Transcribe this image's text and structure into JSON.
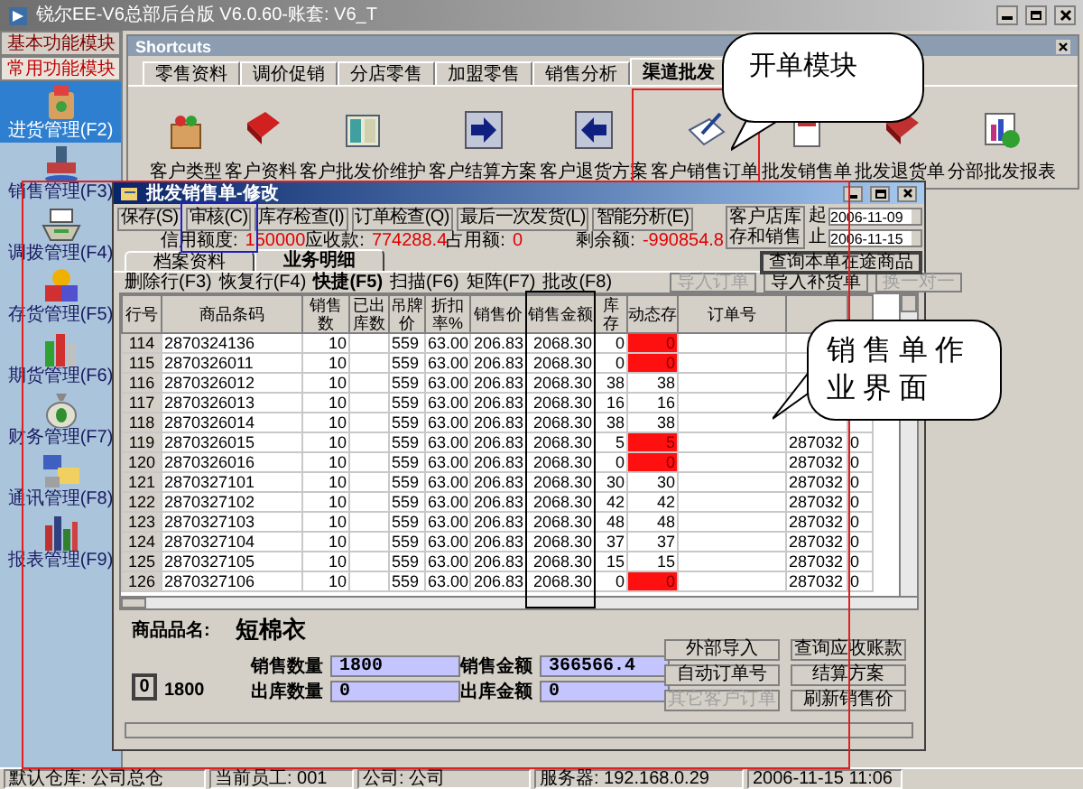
{
  "window": {
    "title": "锐尔EE-V6总部后台版 V6.0.60-账套: V6_T"
  },
  "sidebar": {
    "groups": [
      {
        "label": "基本功能模块",
        "selected": false
      },
      {
        "label": "常用功能模块",
        "selected": true
      }
    ],
    "items": [
      {
        "label": "进货管理(F2)",
        "selected": true
      },
      {
        "label": "销售管理(F3)",
        "selected": false
      },
      {
        "label": "调拨管理(F4)",
        "selected": false
      },
      {
        "label": "存货管理(F5)",
        "selected": false
      },
      {
        "label": "期货管理(F6)",
        "selected": false
      },
      {
        "label": "财务管理(F7)",
        "selected": false
      },
      {
        "label": "通讯管理(F8)",
        "selected": false
      },
      {
        "label": "报表管理(F9)",
        "selected": false
      }
    ]
  },
  "shortcuts": {
    "title": "Shortcuts",
    "tabs": [
      {
        "label": "零售资料",
        "selected": false
      },
      {
        "label": "调价促销",
        "selected": false
      },
      {
        "label": "分店零售",
        "selected": false
      },
      {
        "label": "加盟零售",
        "selected": false
      },
      {
        "label": "销售分析",
        "selected": false
      },
      {
        "label": "渠道批发",
        "selected": true
      }
    ],
    "items": [
      {
        "label": "客户类型"
      },
      {
        "label": "客户资料"
      },
      {
        "label": "客户批发价维护"
      },
      {
        "label": "客户结算方案"
      },
      {
        "label": "客户退货方案"
      },
      {
        "label": "客户销售订单"
      },
      {
        "label": "批发销售单"
      },
      {
        "label": "批发退货单"
      },
      {
        "label": "分部批发报表"
      }
    ]
  },
  "callouts": [
    {
      "text": "开单模块"
    },
    {
      "text": "销售单作业界面"
    }
  ],
  "sales_window": {
    "title": "批发销售单-修改",
    "buttons": [
      {
        "label": "保存(S)"
      },
      {
        "label": "审核(C)"
      },
      {
        "label": "库存检查(I)"
      },
      {
        "label": "订单检查(Q)"
      },
      {
        "label": "最后一次发货(L)"
      },
      {
        "label": "智能分析(E)"
      }
    ],
    "credit": [
      {
        "label": "信用额度:",
        "value": "150000"
      },
      {
        "label": "应收款:",
        "value": "774288.4"
      },
      {
        "label": "占用额:",
        "value": "0"
      },
      {
        "label": "剩余额:",
        "value": "-990854.8"
      }
    ],
    "customer_stock_button": "客户店库存和销售",
    "date_from": {
      "label": "起",
      "value": "2006-11-09"
    },
    "date_to": {
      "label": "止",
      "value": "2006-11-15"
    },
    "query_button": "查询本单在途商品",
    "tabs": [
      {
        "label": "档案资料",
        "selected": false
      },
      {
        "label": "业务明细",
        "selected": true
      }
    ],
    "actions": [
      {
        "label": "删除行(F3)",
        "bold": false
      },
      {
        "label": "恢复行(F4)",
        "bold": false
      },
      {
        "label": "快捷(F5)",
        "bold": true
      },
      {
        "label": "扫描(F6)",
        "bold": false
      },
      {
        "label": "矩阵(F7)",
        "bold": false
      },
      {
        "label": "批改(F8)",
        "bold": false
      }
    ],
    "import_buttons": [
      {
        "label": "导入订单",
        "disabled": true
      },
      {
        "label": "导入补货单",
        "disabled": false
      },
      {
        "label": "换一对一",
        "disabled": true
      }
    ],
    "table": {
      "columns": [
        "行号",
        "商品条码",
        "销售数",
        "已出库数",
        "吊牌价",
        "折扣率%",
        "销售价",
        "销售金额",
        "库存",
        "动态存",
        "订单号"
      ],
      "rows": [
        {
          "no": "114",
          "barcode": "2870324136",
          "qty": "10",
          "tag_price": "559",
          "discount": "63.00",
          "price": "206.83",
          "amount": "2068.30",
          "stock": "0",
          "dynamic_stock": "0",
          "shortage": true
        },
        {
          "no": "115",
          "barcode": "2870326011",
          "qty": "10",
          "tag_price": "559",
          "discount": "63.00",
          "price": "206.83",
          "amount": "2068.30",
          "stock": "0",
          "dynamic_stock": "0",
          "shortage": true
        },
        {
          "no": "116",
          "barcode": "2870326012",
          "qty": "10",
          "tag_price": "559",
          "discount": "63.00",
          "price": "206.83",
          "amount": "2068.30",
          "stock": "38",
          "dynamic_stock": "38",
          "shortage": false
        },
        {
          "no": "117",
          "barcode": "2870326013",
          "qty": "10",
          "tag_price": "559",
          "discount": "63.00",
          "price": "206.83",
          "amount": "2068.30",
          "stock": "16",
          "dynamic_stock": "16",
          "shortage": false
        },
        {
          "no": "118",
          "barcode": "2870326014",
          "qty": "10",
          "tag_price": "559",
          "discount": "63.00",
          "price": "206.83",
          "amount": "2068.30",
          "stock": "38",
          "dynamic_stock": "38",
          "shortage": false
        },
        {
          "no": "119",
          "barcode": "2870326015",
          "qty": "10",
          "tag_price": "559",
          "discount": "63.00",
          "price": "206.83",
          "amount": "2068.30",
          "stock": "5",
          "dynamic_stock": "5",
          "shortage": true,
          "column_12": "287032",
          "column_13": "0"
        },
        {
          "no": "120",
          "barcode": "2870326016",
          "qty": "10",
          "tag_price": "559",
          "discount": "63.00",
          "price": "206.83",
          "amount": "2068.30",
          "stock": "0",
          "dynamic_stock": "0",
          "shortage": true,
          "column_12": "287032",
          "column_13": "0"
        },
        {
          "no": "121",
          "barcode": "2870327101",
          "qty": "10",
          "tag_price": "559",
          "discount": "63.00",
          "price": "206.83",
          "amount": "2068.30",
          "stock": "30",
          "dynamic_stock": "30",
          "shortage": false,
          "column_12": "287032",
          "column_13": "0"
        },
        {
          "no": "122",
          "barcode": "2870327102",
          "qty": "10",
          "tag_price": "559",
          "discount": "63.00",
          "price": "206.83",
          "amount": "2068.30",
          "stock": "42",
          "dynamic_stock": "42",
          "shortage": false,
          "column_12": "287032",
          "column_13": "0"
        },
        {
          "no": "123",
          "barcode": "2870327103",
          "qty": "10",
          "tag_price": "559",
          "discount": "63.00",
          "price": "206.83",
          "amount": "2068.30",
          "stock": "48",
          "dynamic_stock": "48",
          "shortage": false,
          "column_12": "287032",
          "column_13": "0"
        },
        {
          "no": "124",
          "barcode": "2870327104",
          "qty": "10",
          "tag_price": "559",
          "discount": "63.00",
          "price": "206.83",
          "amount": "2068.30",
          "stock": "37",
          "dynamic_stock": "37",
          "shortage": false,
          "column_12": "287032",
          "column_13": "0"
        },
        {
          "no": "125",
          "barcode": "2870327105",
          "qty": "10",
          "tag_price": "559",
          "discount": "63.00",
          "price": "206.83",
          "amount": "2068.30",
          "stock": "15",
          "dynamic_stock": "15",
          "shortage": false,
          "column_12": "287032",
          "column_13": "0"
        },
        {
          "no": "126",
          "barcode": "2870327106",
          "qty": "10",
          "tag_price": "559",
          "discount": "63.00",
          "price": "206.83",
          "amount": "2068.30",
          "stock": "0",
          "dynamic_stock": "0",
          "shortage": true,
          "column_12": "287032",
          "column_13": "0"
        }
      ]
    },
    "summary": {
      "product_label": "商品品名:",
      "product_name": "短棉衣",
      "count_button": "0",
      "count_text": "1800",
      "fields": [
        {
          "label": "销售数量",
          "value": "1800"
        },
        {
          "label": "销售金额",
          "value": "366566.4"
        },
        {
          "label": "出库数量",
          "value": "0"
        },
        {
          "label": "出库金额",
          "value": "0"
        }
      ],
      "buttons": [
        {
          "label": "外部导入",
          "disabled": false
        },
        {
          "label": "自动订单号",
          "disabled": false
        },
        {
          "label": "其它客户订单",
          "disabled": true
        },
        {
          "label": "查询应收账款",
          "disabled": false
        },
        {
          "label": "结算方案",
          "disabled": false
        },
        {
          "label": "刷新销售价",
          "disabled": false
        }
      ]
    }
  },
  "status_bar": [
    "默认仓库: 公司总仓",
    "当前员工: 001",
    "公司: 公司",
    "服务器: 192.168.0.29",
    "2006-11-15 11:06"
  ]
}
